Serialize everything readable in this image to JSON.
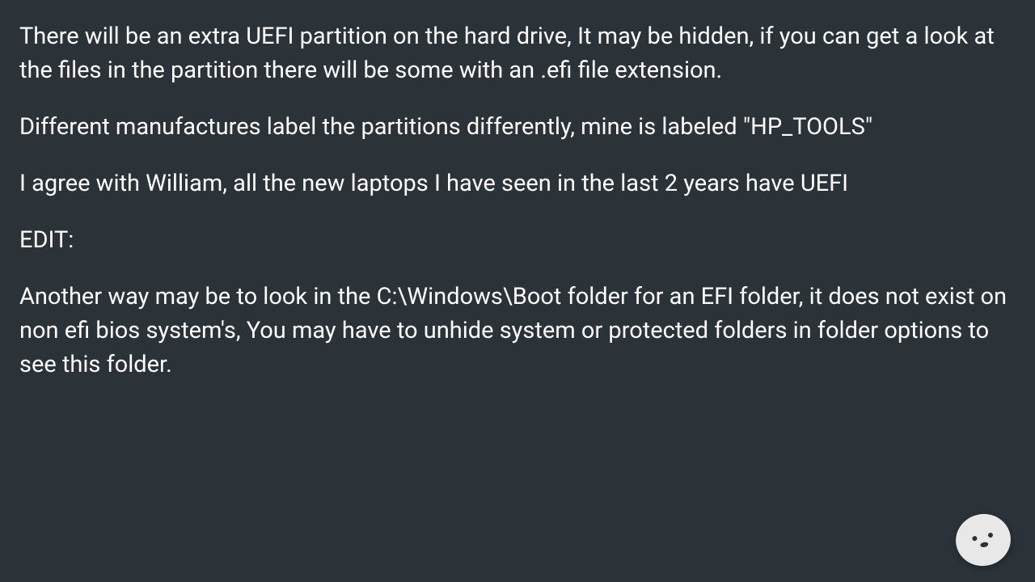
{
  "post": {
    "paragraphs": [
      "There will be an extra UEFI partition on the hard drive, It may be hidden, if you can get a look at the files in the partition there will be some with an .efi file extension.",
      "Different manufactures label the partitions differently, mine is labeled \"HP_TOOLS\"",
      "I agree with William, all the new laptops I have seen in the last 2 years have UEFI",
      "EDIT:",
      "Another way may be to look in the C:\\Windows\\Boot folder for an EFI folder, it does not exist on non efi bios system's, You may have to unhide system or protected folders in folder options to see this folder."
    ]
  }
}
